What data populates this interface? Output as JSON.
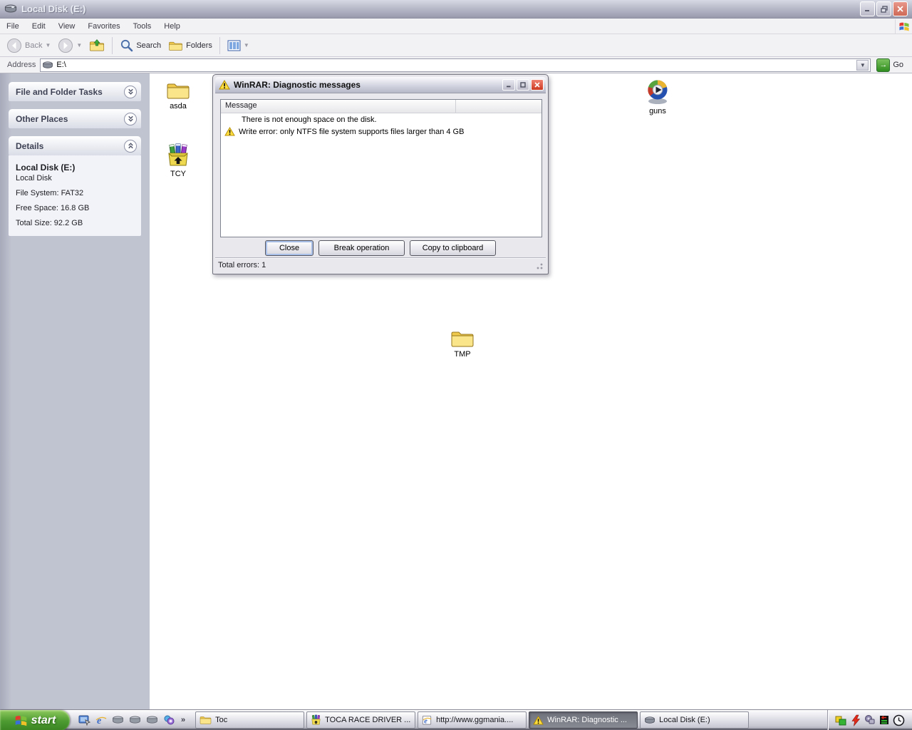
{
  "window": {
    "title": "Local Disk (E:)",
    "menu": [
      "File",
      "Edit",
      "View",
      "Favorites",
      "Tools",
      "Help"
    ],
    "toolbar": {
      "back": "Back",
      "search": "Search",
      "folders": "Folders"
    },
    "address": {
      "label": "Address",
      "value": "E:\\",
      "go": "Go"
    }
  },
  "sidebar": {
    "panels": [
      {
        "title": "File and Folder Tasks",
        "state": "collapsed"
      },
      {
        "title": "Other Places",
        "state": "collapsed"
      },
      {
        "title": "Details",
        "state": "expanded"
      }
    ],
    "details": {
      "name": "Local Disk (E:)",
      "type": "Local Disk",
      "filesystem": "File System: FAT32",
      "free": "Free Space: 16.8 GB",
      "total": "Total Size: 92.2 GB"
    }
  },
  "desktop": {
    "icons": [
      {
        "label": "asda",
        "type": "folder"
      },
      {
        "label": "TCY",
        "type": "winrar-archive"
      },
      {
        "label": "guns",
        "type": "media-player"
      },
      {
        "label": "TMP",
        "type": "folder"
      }
    ]
  },
  "dialog": {
    "title": "WinRAR: Diagnostic messages",
    "column": "Message",
    "messages": [
      {
        "icon": "none",
        "text": "There is not enough space on the disk."
      },
      {
        "icon": "warning",
        "text": "Write error: only NTFS file system supports files larger than 4 GB"
      }
    ],
    "buttons": [
      "Close",
      "Break operation",
      "Copy to clipboard"
    ],
    "status": "Total errors: 1"
  },
  "taskbar": {
    "start_label": "start",
    "quick_launch_icons": [
      "show-desktop",
      "internet-explorer",
      "drive",
      "drive",
      "drive",
      "messenger"
    ],
    "overflow_chevron": "»",
    "tasks": [
      {
        "label": "Toc",
        "icon": "folder",
        "active": false
      },
      {
        "label": "TOCA RACE DRIVER ...",
        "icon": "winrar",
        "active": false
      },
      {
        "label": "http://www.ggmania....",
        "icon": "internet-explorer",
        "active": false
      },
      {
        "label": "WinRAR: Diagnostic ...",
        "icon": "warning",
        "active": true
      },
      {
        "label": "Local Disk (E:)",
        "icon": "drive",
        "active": false
      }
    ],
    "tray_icons": [
      "app-squares",
      "lightning",
      "network-device",
      "traffic-monitor",
      "clock"
    ]
  },
  "colors": {
    "titlebar_silver": "#b9bbca",
    "sidebar": "#c0c3d0",
    "start_green": "#4c9a31",
    "active_task_gray": "#6e707a",
    "warning_yellow": "#ffde3f",
    "go_green": "#2f8d1f",
    "close_red": "#cc3a22"
  }
}
